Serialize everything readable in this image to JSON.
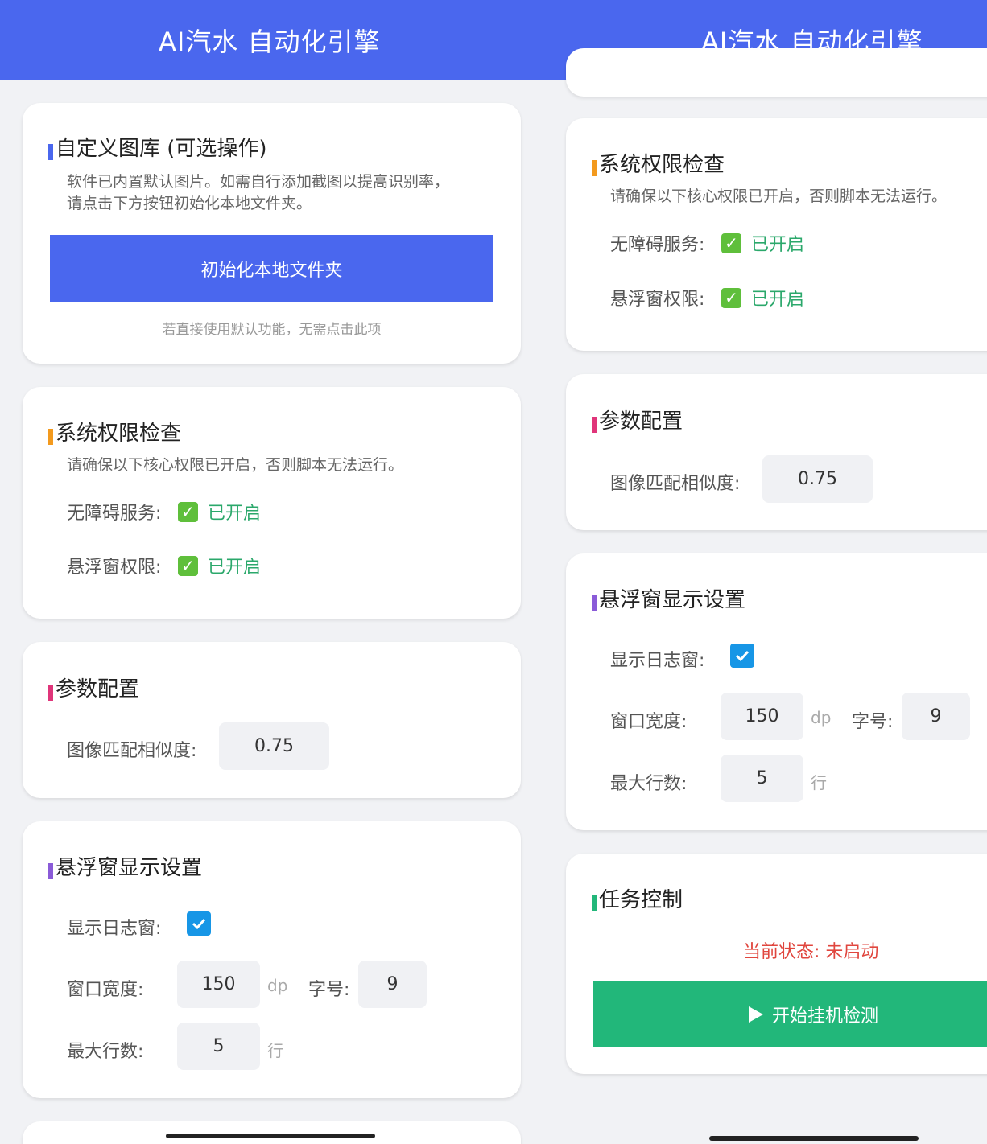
{
  "app_title": "AI汽水 自动化引擎",
  "gallery_card": {
    "title": "自定义图库 (可选操作)",
    "desc_line1": "软件已内置默认图片。如需自行添加截图以提高识别率，",
    "desc_line2": "请点击下方按钮初始化本地文件夹。",
    "button_label": "初始化本地文件夹",
    "hint": "若直接使用默认功能，无需点击此项"
  },
  "permission_card": {
    "title": "系统权限检查",
    "desc": "请确保以下核心权限已开启，否则脚本无法运行。",
    "accessibility_label": "无障碍服务:",
    "accessibility_status": "已开启",
    "overlay_label": "悬浮窗权限:",
    "overlay_status": "已开启"
  },
  "params_card": {
    "title": "参数配置",
    "similarity_label": "图像匹配相似度:",
    "similarity_value": "0.75"
  },
  "overlay_card": {
    "title": "悬浮窗显示设置",
    "show_log_label": "显示日志窗:",
    "show_log_checked": true,
    "width_label": "窗口宽度:",
    "width_value": "150",
    "width_unit": "dp",
    "font_label": "字号:",
    "font_value": "9",
    "max_lines_label": "最大行数:",
    "max_lines_value": "5",
    "max_lines_unit": "行"
  },
  "task_card": {
    "title": "任务控制",
    "status": "当前状态: 未启动",
    "start_label": "开始挂机检测"
  },
  "colors": {
    "accent": "#4a67ee",
    "start": "#22b77a",
    "status_ok": "#2ba86b",
    "status_off": "#e0463e",
    "bar_gallery": "#4a67ee",
    "bar_permission": "#f39a1e",
    "bar_params": "#e0357a",
    "bar_overlay": "#8a5bd8",
    "bar_task": "#22b77a"
  }
}
